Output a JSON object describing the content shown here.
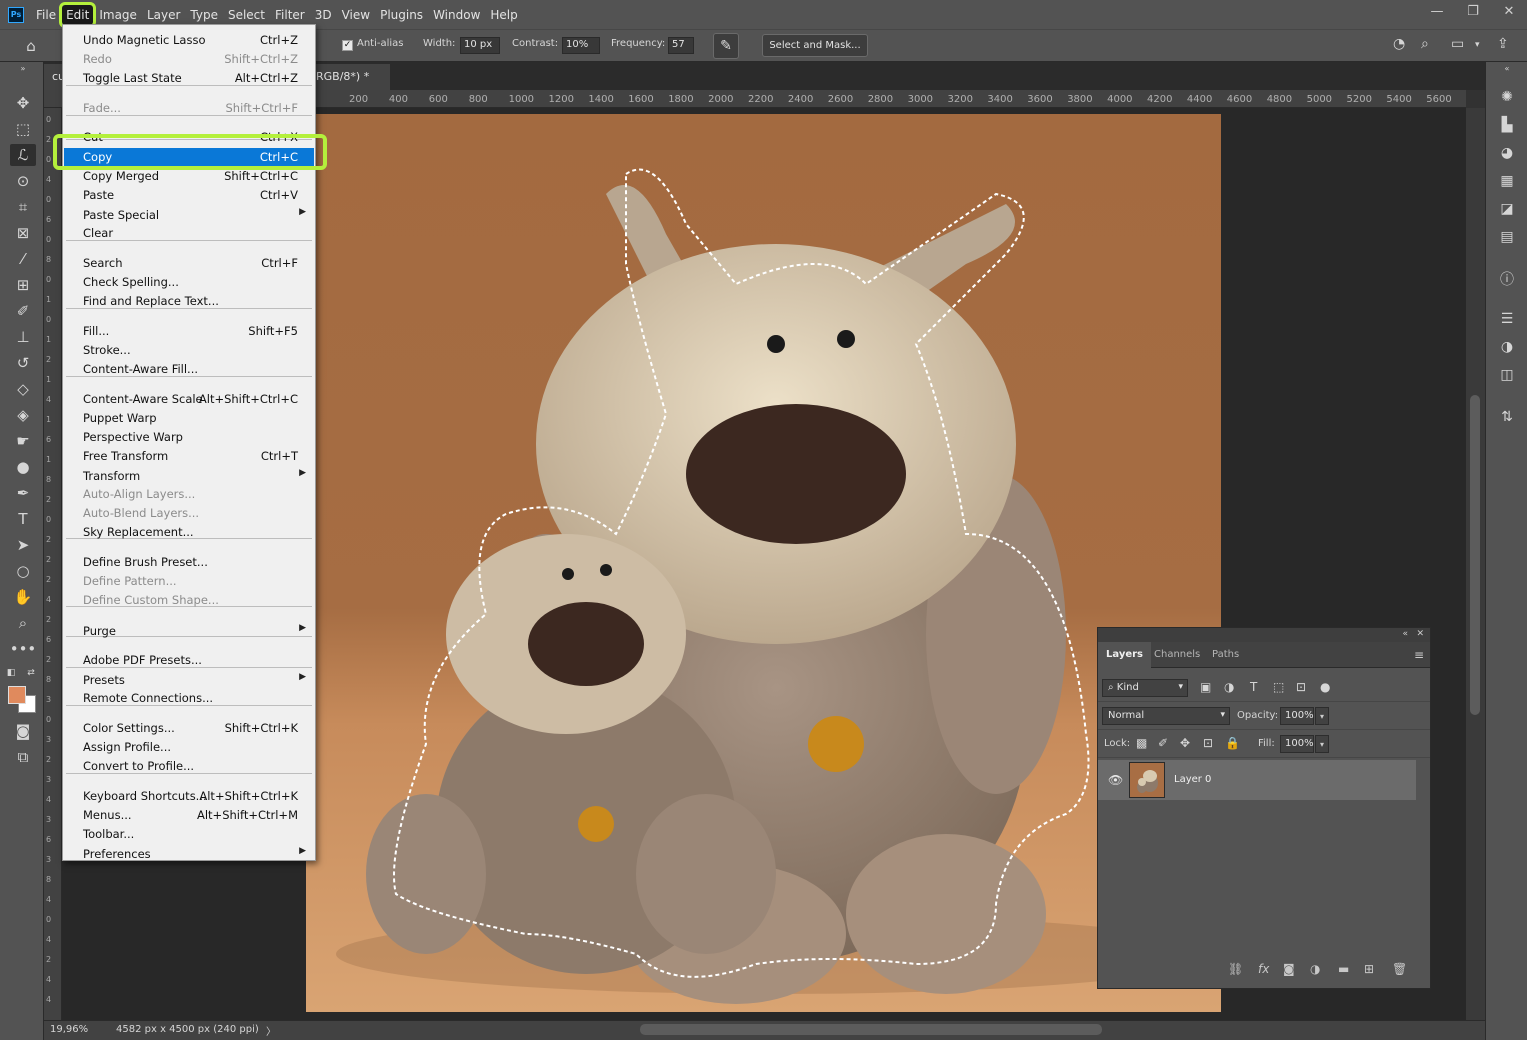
{
  "app": {
    "logo_text": "Ps"
  },
  "menubar": {
    "items": [
      "File",
      "Edit",
      "Image",
      "Layer",
      "Type",
      "Select",
      "Filter",
      "3D",
      "View",
      "Plugins",
      "Window",
      "Help"
    ],
    "active": "Edit"
  },
  "window_controls": {
    "minimize": "—",
    "restore": "❐",
    "close": "✕"
  },
  "options": {
    "antialias_label": "Anti-alias",
    "width_label": "Width:",
    "width_value": "10 px",
    "contrast_label": "Contrast:",
    "contrast_value": "10%",
    "frequency_label": "Frequency:",
    "frequency_value": "57",
    "select_mask": "Select and Mask..."
  },
  "document": {
    "tab_left": "cu",
    "tab_title": "RGB/8*) *",
    "zoom": "19,96%",
    "info": "4582 px x 4500 px (240 ppi)"
  },
  "ruler": {
    "h_labels": [
      "200",
      "400",
      "600",
      "800",
      "1000",
      "1200",
      "1400",
      "1600",
      "1800",
      "2000",
      "2200",
      "2400",
      "2600",
      "2800",
      "3000",
      "3200",
      "3400",
      "3600",
      "3800",
      "4000",
      "4200",
      "4400",
      "4600",
      "4800",
      "5000",
      "5200",
      "5400",
      "5600"
    ],
    "v_digits": [
      "0",
      "2",
      "0",
      "4",
      "0",
      "6",
      "0",
      "8",
      "0",
      "1",
      "0",
      "1",
      "2",
      "1",
      "4",
      "1",
      "6",
      "1",
      "8",
      "2",
      "0",
      "2",
      "2",
      "2",
      "4",
      "2",
      "6",
      "2",
      "8",
      "3",
      "0",
      "3",
      "2",
      "3",
      "4",
      "3",
      "6",
      "3",
      "8",
      "4",
      "0",
      "4",
      "2",
      "4",
      "4"
    ]
  },
  "edit_menu": {
    "items": [
      {
        "label": "Undo Magnetic Lasso",
        "shortcut": "Ctrl+Z",
        "state": "normal"
      },
      {
        "label": "Redo",
        "shortcut": "Shift+Ctrl+Z",
        "state": "disabled"
      },
      {
        "label": "Toggle Last State",
        "shortcut": "Alt+Ctrl+Z",
        "state": "normal"
      },
      {
        "label": "Fade...",
        "shortcut": "Shift+Ctrl+F",
        "state": "disabled"
      },
      {
        "label": "Cut",
        "shortcut": "Ctrl+X",
        "state": "normal"
      },
      {
        "label": "Copy",
        "shortcut": "Ctrl+C",
        "state": "highlighted"
      },
      {
        "label": "Copy Merged",
        "shortcut": "Shift+Ctrl+C",
        "state": "normal"
      },
      {
        "label": "Paste",
        "shortcut": "Ctrl+V",
        "state": "normal"
      },
      {
        "label": "Paste Special",
        "shortcut": "",
        "state": "submenu"
      },
      {
        "label": "Clear",
        "shortcut": "",
        "state": "normal"
      },
      {
        "label": "Search",
        "shortcut": "Ctrl+F",
        "state": "normal"
      },
      {
        "label": "Check Spelling...",
        "shortcut": "",
        "state": "normal"
      },
      {
        "label": "Find and Replace Text...",
        "shortcut": "",
        "state": "normal"
      },
      {
        "label": "Fill...",
        "shortcut": "Shift+F5",
        "state": "normal"
      },
      {
        "label": "Stroke...",
        "shortcut": "",
        "state": "normal"
      },
      {
        "label": "Content-Aware Fill...",
        "shortcut": "",
        "state": "normal"
      },
      {
        "label": "Content-Aware Scale",
        "shortcut": "Alt+Shift+Ctrl+C",
        "state": "normal"
      },
      {
        "label": "Puppet Warp",
        "shortcut": "",
        "state": "normal"
      },
      {
        "label": "Perspective Warp",
        "shortcut": "",
        "state": "normal"
      },
      {
        "label": "Free Transform",
        "shortcut": "Ctrl+T",
        "state": "normal"
      },
      {
        "label": "Transform",
        "shortcut": "",
        "state": "submenu"
      },
      {
        "label": "Auto-Align Layers...",
        "shortcut": "",
        "state": "disabled"
      },
      {
        "label": "Auto-Blend Layers...",
        "shortcut": "",
        "state": "disabled"
      },
      {
        "label": "Sky Replacement...",
        "shortcut": "",
        "state": "normal"
      },
      {
        "label": "Define Brush Preset...",
        "shortcut": "",
        "state": "normal"
      },
      {
        "label": "Define Pattern...",
        "shortcut": "",
        "state": "disabled"
      },
      {
        "label": "Define Custom Shape...",
        "shortcut": "",
        "state": "disabled"
      },
      {
        "label": "Purge",
        "shortcut": "",
        "state": "submenu"
      },
      {
        "label": "Adobe PDF Presets...",
        "shortcut": "",
        "state": "normal"
      },
      {
        "label": "Presets",
        "shortcut": "",
        "state": "submenu"
      },
      {
        "label": "Remote Connections...",
        "shortcut": "",
        "state": "normal"
      },
      {
        "label": "Color Settings...",
        "shortcut": "Shift+Ctrl+K",
        "state": "normal"
      },
      {
        "label": "Assign Profile...",
        "shortcut": "",
        "state": "normal"
      },
      {
        "label": "Convert to Profile...",
        "shortcut": "",
        "state": "normal"
      },
      {
        "label": "Keyboard Shortcuts...",
        "shortcut": "Alt+Shift+Ctrl+K",
        "state": "normal"
      },
      {
        "label": "Menus...",
        "shortcut": "Alt+Shift+Ctrl+M",
        "state": "normal"
      },
      {
        "label": "Toolbar...",
        "shortcut": "",
        "state": "normal"
      },
      {
        "label": "Preferences",
        "shortcut": "",
        "state": "submenu"
      }
    ]
  },
  "layers_panel": {
    "tabs": [
      "Layers",
      "Channels",
      "Paths"
    ],
    "active_tab": "Layers",
    "filter_kind": "Kind",
    "blend_mode": "Normal",
    "opacity_label": "Opacity:",
    "opacity_value": "100%",
    "lock_label": "Lock:",
    "fill_label": "Fill:",
    "fill_value": "100%",
    "layer_name": "Layer 0"
  },
  "colors": {
    "menu_highlight": "#0a78d7",
    "annotation_ring": "#b4f03c",
    "foreground": "#e08a5d",
    "background": "#ffffff"
  }
}
